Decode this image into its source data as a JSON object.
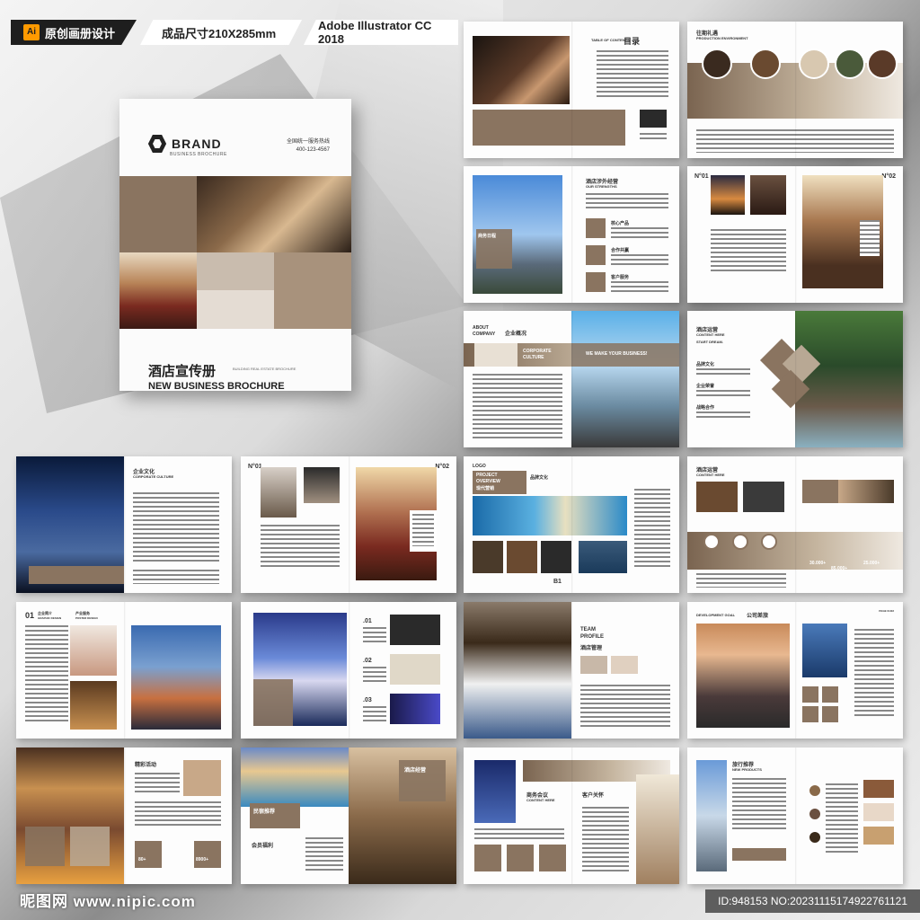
{
  "header": {
    "badge_icon": "Ai",
    "tag_design": "原创画册设计",
    "tag_size": "成品尺寸210X285mm",
    "tag_software": "Adobe Illustrator CC 2018"
  },
  "cover": {
    "brand": "BRAND",
    "brand_sub": "BUSINESS BROCHURE",
    "contact_line1": "全国统一服务热线",
    "contact_line2": "400-123-4567",
    "title_cn": "酒店宣传册",
    "title_small": "BUILDING REAL ESTATE BROCHURE",
    "title_en": "NEW BUSINESS BROCHURE"
  },
  "spreads": {
    "s1": {
      "toc_label": "TABLE OF CONTENTS",
      "toc_cn": "目录"
    },
    "s2": {
      "title": "往期礼遇",
      "subtitle": "PRODUCTION ENVIRONMENT"
    },
    "s3": {
      "title": "酒店涉外经营",
      "subtitle": "OUR STRENGTHS",
      "item1": "核心产品",
      "item2": "合作共赢",
      "item3": "客户服务",
      "photo_label": "商务日程"
    },
    "s4": {
      "n1": "N°01",
      "n2": "N°02"
    },
    "s5": {
      "about": "ABOUT",
      "company": "COMPANY",
      "cn": "企业概况",
      "culture1": "CORPORATE",
      "culture2": "CULTURE",
      "make": "WE MAKE YOUR BUSINESS!"
    },
    "s6": {
      "title": "酒店运营",
      "subtitle": "CONTENT HERE",
      "start": "START DREAM.",
      "i1": "品牌文化",
      "i2": "企业荣誉",
      "i3": "战略合作"
    },
    "s7": {
      "title": "企业文化",
      "subtitle": "CORPORATE CULTURE"
    },
    "s8": {
      "n1": "N°01",
      "n2": "N°02"
    },
    "s9": {
      "logo": "LOGO",
      "p1": "PROJECT",
      "p2": "OVERVIEW",
      "cn": "现代营销",
      "brand": "品牌文化",
      "num": "B1"
    },
    "s10": {
      "title": "酒店运营",
      "subtitle": "CONTENT HERE",
      "v1": "30.000+",
      "v2": "85.000+",
      "v3": "25.000+"
    },
    "s11": {
      "num": "01",
      "cn": "企业简介",
      "en": "GRAPHIC DESIGN",
      "cn2": "产业服务",
      "en2": "POSTER DESIGN"
    },
    "s12": {
      "n1": ".01",
      "n2": ".02",
      "n3": ".03"
    },
    "s13": {
      "t1": "TEAM",
      "t2": "PROFILE",
      "cn": "酒店管理"
    },
    "s14": {
      "title": "DEVELOPMENT GOAL",
      "cn": "公司差旅",
      "page": "PAGE 01/02"
    },
    "s15": {
      "title": "精彩活动",
      "v1": "80+",
      "v2": "8900+"
    },
    "s16": {
      "cn1": "酒店经营",
      "cn2": "民宿推荐",
      "cn3": "会员福利"
    },
    "s17": {
      "cn1": "商务会议",
      "cn2": "客户关怀",
      "sub": "CONTENT HERE"
    },
    "s18": {
      "title": "旅行推荐",
      "subtitle": "NEW PRODUCTS"
    }
  },
  "watermark": {
    "left": "昵图网 www.nipic.com",
    "right": "ID:948153 NO:20231115174922761121"
  },
  "colors": {
    "accent": "#8a7460",
    "light": "#cbbca8",
    "dark": "#1e1e1e",
    "orange": "#ff9a00"
  }
}
